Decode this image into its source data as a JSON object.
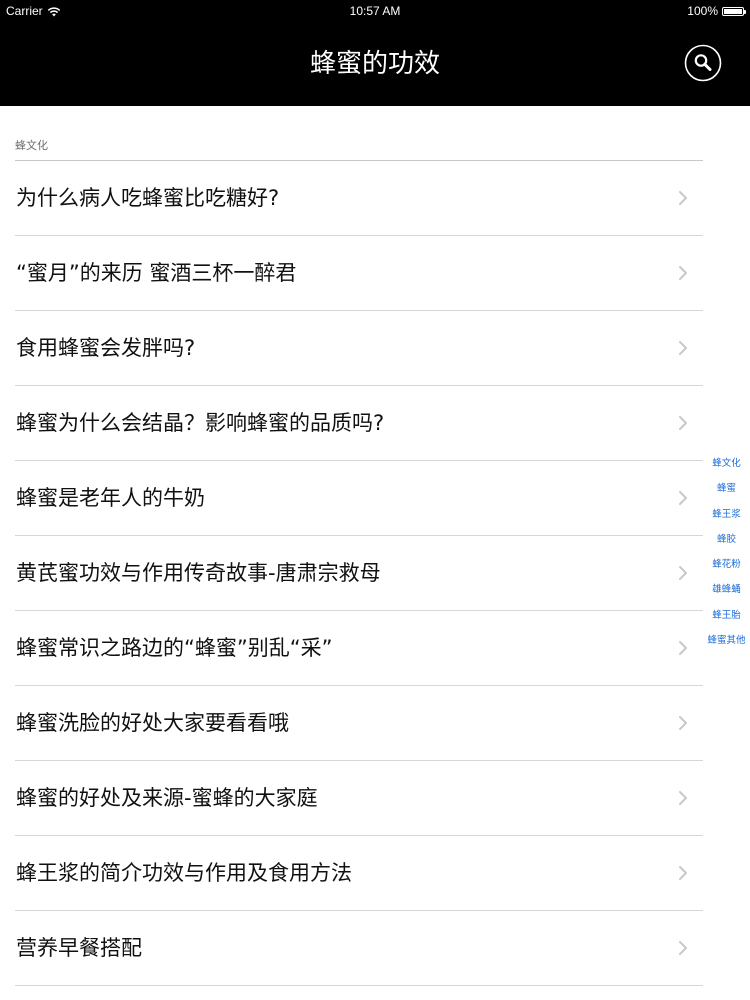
{
  "status_bar": {
    "carrier": "Carrier",
    "wifi_icon": "wifi-icon",
    "time": "10:57 AM",
    "battery_percent": "100%",
    "battery_icon": "battery-icon",
    "battery_level": 1.0
  },
  "nav": {
    "title": "蜂蜜的功效",
    "search_icon": "search-icon",
    "background": "#000000",
    "text_color": "#ffffff"
  },
  "section": {
    "header": "蜂文化"
  },
  "items": [
    {
      "label": "为什么病人吃蜂蜜比吃糖好?"
    },
    {
      "label": "“蜜月”的来历 蜜酒三杯一醉君"
    },
    {
      "label": "食用蜂蜜会发胖吗?"
    },
    {
      "label": "蜂蜜为什么会结晶？影响蜂蜜的品质吗?"
    },
    {
      "label": "蜂蜜是老年人的牛奶"
    },
    {
      "label": "黄芪蜜功效与作用传奇故事-唐肃宗救母"
    },
    {
      "label": "蜂蜜常识之路边的“蜂蜜”别乱“采”"
    },
    {
      "label": "蜂蜜洗脸的好处大家要看看哦"
    },
    {
      "label": "蜂蜜的好处及来源-蜜蜂的大家庭"
    },
    {
      "label": "蜂王浆的简介功效与作用及食用方法"
    },
    {
      "label": "营养早餐搭配"
    }
  ],
  "chevron_icon": "chevron-right-icon",
  "index": {
    "items": [
      "蜂文化",
      "蜂蜜",
      "蜂王浆",
      "蜂胶",
      "蜂花粉",
      "雄蜂蛹",
      "蜂王胎",
      "蜂蜜其他"
    ],
    "color": "#1c6dd8"
  }
}
